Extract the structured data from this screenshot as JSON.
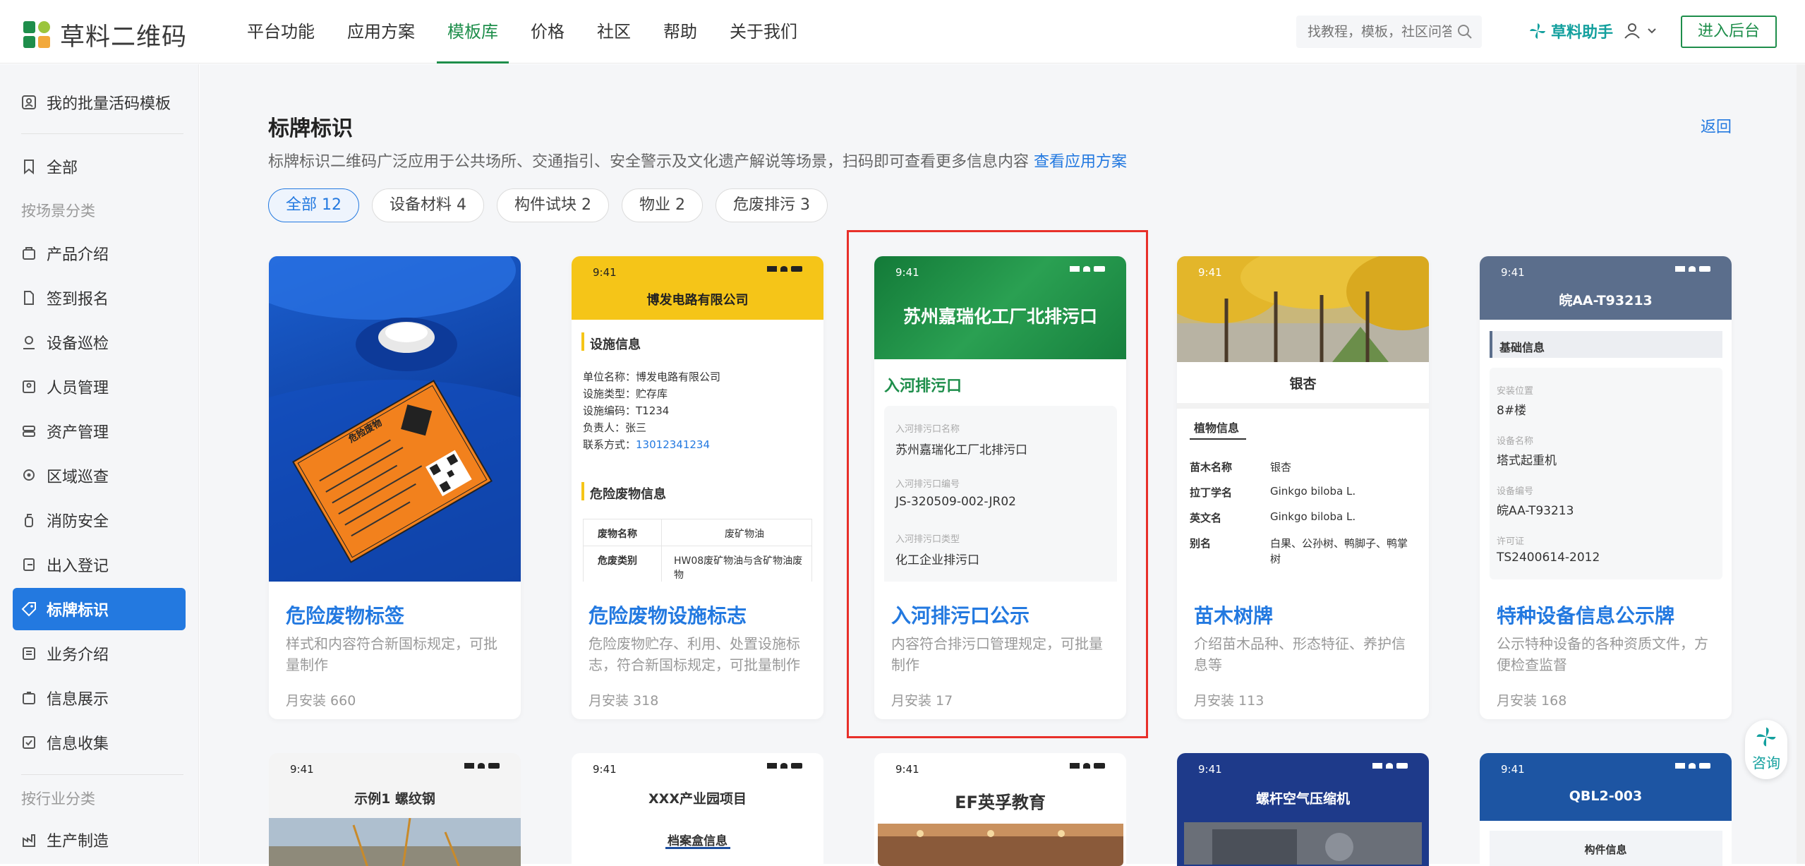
{
  "header": {
    "logo_text": "草料二维码",
    "nav": [
      "平台功能",
      "应用方案",
      "模板库",
      "价格",
      "社区",
      "帮助",
      "关于我们"
    ],
    "active_nav": "模板库",
    "search_placeholder": "找教程，模板，社区问答",
    "assistant": "草料助手",
    "enter_button": "进入后台"
  },
  "sidebar": {
    "top_item": "我的批量活码模板",
    "all": "全部",
    "scene_group": "按场景分类",
    "items": [
      "产品介绍",
      "签到报名",
      "设备巡检",
      "人员管理",
      "资产管理",
      "区域巡查",
      "消防安全",
      "出入登记",
      "标牌标识",
      "业务介绍",
      "信息展示",
      "信息收集"
    ],
    "active": "标牌标识",
    "industry_group": "按行业分类",
    "industry_items": [
      "生产制造"
    ]
  },
  "page": {
    "title": "标牌标识",
    "back": "返回",
    "description": "标牌标识二维码广泛应用于公共场所、交通指引、安全警示及文化遗产解说等场景，扫码即可查看更多信息内容",
    "link": "查看应用方案"
  },
  "filters": [
    "全部 12",
    "设备材料 4",
    "构件试块 2",
    "物业 2",
    "危废排污 3"
  ],
  "active_filter": "全部 12",
  "cards": [
    {
      "title": "危险废物标签",
      "desc": "样式和内容符合新国标规定，可批量制作",
      "installs_label": "月安装",
      "installs": "660"
    },
    {
      "title": "危险废物设施标志",
      "desc": "危险废物贮存、利用、处置设施标志，符合新国标规定，可批量制作",
      "installs_label": "月安装",
      "installs": "318"
    },
    {
      "title": "入河排污口公示",
      "desc": "内容符合排污口管理规定，可批量制作",
      "installs_label": "月安装",
      "installs": "17"
    },
    {
      "title": "苗木树牌",
      "desc": "介绍苗木品种、形态特征、养护信息等",
      "installs_label": "月安装",
      "installs": "113"
    },
    {
      "title": "特种设备信息公示牌",
      "desc": "公示特种设备的各种资质文件，方便检查监督",
      "installs_label": "月安装",
      "installs": "168"
    }
  ],
  "previews": {
    "time": "9:41",
    "c1": {
      "label_title": "危险废物"
    },
    "c2": {
      "company": "博发电路有限公司",
      "section1": "设施信息",
      "lines": [
        "单位名称：博发电路有限公司",
        "设施类型：贮存库",
        "设施编码：T1234",
        "负责人：张三",
        "联系方式："
      ],
      "phone": "13012341234",
      "section2": "危险废物信息",
      "table": [
        [
          "废物名称",
          "废矿物油"
        ],
        [
          "危废类别",
          "HW08废矿物油与含矿物油废物"
        ]
      ]
    },
    "c3": {
      "banner": "苏州嘉瑞化工厂北排污口",
      "heading": "入河排污口",
      "fields": [
        [
          "入河排污口名称",
          "苏州嘉瑞化工厂北排污口"
        ],
        [
          "入河排污口编号",
          "JS-320509-002-JR02"
        ],
        [
          "入河排污口类型",
          "化工企业排污口"
        ]
      ]
    },
    "c4": {
      "name": "银杏",
      "section": "植物信息",
      "rows": [
        [
          "苗木名称",
          "银杏"
        ],
        [
          "拉丁学名",
          "Ginkgo biloba L."
        ],
        [
          "英文名",
          "Ginkgo biloba L."
        ],
        [
          "别名",
          "白果、公孙树、鸭脚子、鸭掌树"
        ]
      ]
    },
    "c5": {
      "plate": "皖AA-T93213",
      "section": "基础信息",
      "fields": [
        [
          "安装位置",
          "8#楼"
        ],
        [
          "设备名称",
          "塔式起重机"
        ],
        [
          "设备编号",
          "皖AA-T93213"
        ],
        [
          "许可证",
          "TS2400614-2012"
        ]
      ]
    },
    "r2": [
      "示例1 螺纹钢",
      "XXX产业园项目",
      "EF英孚教育",
      "螺杆空气压缩机",
      "QBL2-003"
    ],
    "r2_sub2": "档案盒信息",
    "r2_sub5": "构件信息"
  },
  "consult": "咨询",
  "colors": {
    "brand_green": "#1e8e4b",
    "accent_blue": "#2379e0",
    "highlight_red": "#e8302a",
    "assistant_teal": "#13a09e"
  }
}
